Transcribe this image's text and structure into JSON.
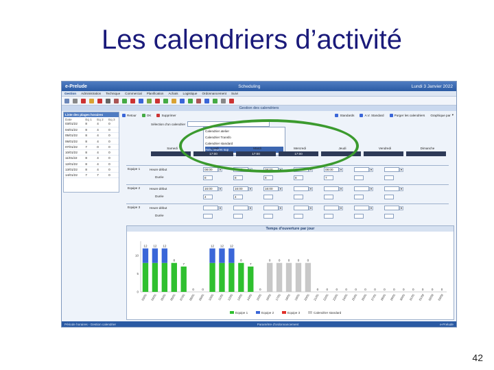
{
  "slide": {
    "title": "Les calendriers d’activité",
    "page_number": "42"
  },
  "app": {
    "brand": "e-Prelude",
    "window_title": "Scheduling",
    "date": "Lundi 3 Janvier 2022",
    "menu": [
      "Gestion",
      "Administration",
      "Technique",
      "Commercial",
      "Planification",
      "Achats",
      "Logistique",
      "Ordonnancement",
      "Suivi"
    ],
    "section_title": "Gestion des calendriers",
    "left_panel": {
      "header": "Liste des plages horaires",
      "columns": [
        "Date",
        "Eq 1",
        "Eq 2",
        "Eq 3"
      ],
      "rows": [
        [
          "03/01/22",
          "8",
          "4",
          "0"
        ],
        [
          "04/01/22",
          "8",
          "4",
          "0"
        ],
        [
          "05/01/22",
          "8",
          "4",
          "0"
        ],
        [
          "06/01/22",
          "8",
          "4",
          "0"
        ],
        [
          "07/01/22",
          "7",
          "0",
          "0"
        ],
        [
          "10/01/22",
          "8",
          "4",
          "0"
        ],
        [
          "11/01/22",
          "8",
          "4",
          "0"
        ],
        [
          "12/01/22",
          "8",
          "4",
          "0"
        ],
        [
          "13/01/22",
          "8",
          "4",
          "0"
        ],
        [
          "14/01/22",
          "7",
          "7",
          "0"
        ]
      ]
    },
    "actions": {
      "back": "Retour",
      "ok": "OK",
      "delete": "Supprimer",
      "standards": "Standards",
      "std": "A.V. Standard",
      "purge": "Purger les calendriers",
      "chart_by": "Graphique par"
    },
    "calendar_select_label": "Sélection d'un calendrier",
    "dropdown_options": [
      "Calendrier atelier",
      "Calendrier Transfo",
      "Calendrier standard",
      "Avec heures sup"
    ],
    "days": [
      "Samedi",
      "Lundi",
      "Mardi",
      "Mercredi",
      "Jeudi",
      "Vendredi",
      "Dimanche"
    ],
    "day_cells": [
      "",
      "17:00",
      "17:00",
      "17:00",
      "",
      "",
      ""
    ],
    "teams": [
      {
        "name": "Equipe 1",
        "start_label": "Heure début",
        "duration_label": "Durée",
        "starts": [
          "08:00",
          "08:00",
          "08:00",
          "07:00",
          "08:00"
        ],
        "durations": [
          "8",
          "8",
          "8",
          "8",
          "7"
        ]
      },
      {
        "name": "Equipe 2",
        "start_label": "Heure début",
        "duration_label": "Durée",
        "starts": [
          "16:00",
          "16:00",
          "16:00"
        ],
        "durations": [
          "4",
          "4",
          ""
        ]
      },
      {
        "name": "Equipe 3",
        "start_label": "Heure début",
        "duration_label": "Durée",
        "starts": [],
        "durations": []
      }
    ],
    "status_left": "Période horaires - Gestion calendrier",
    "status_mid": "Paramètre d'ordonnancement",
    "status_right": "e-Prelude"
  },
  "colors": {
    "team1": "#2fc02f",
    "team2": "#3a66d8",
    "team3": "#e0302a",
    "standard": "#c8c8c8",
    "highlight": "#3b9a2e",
    "title": "#1a1a7a"
  },
  "chart_data": {
    "type": "bar",
    "title": "Temps d'ouverture par jour",
    "ylim": [
      0,
      14
    ],
    "categories": [
      "03/01",
      "04/01",
      "05/01",
      "06/01",
      "07/01",
      "08/01",
      "09/01",
      "10/01",
      "11/01",
      "12/01",
      "13/01",
      "14/01",
      "15/01",
      "16/01",
      "17/01",
      "18/01",
      "19/01",
      "20/01",
      "21/01",
      "22/01",
      "23/01",
      "24/01",
      "25/01",
      "26/01",
      "27/01",
      "28/01",
      "29/01",
      "30/01",
      "31/01",
      "01/02",
      "02/02",
      "03/02"
    ],
    "series": [
      {
        "name": "Equipe 1",
        "values": [
          8,
          8,
          8,
          8,
          7,
          0,
          0,
          8,
          8,
          8,
          8,
          7,
          0,
          0,
          0,
          0,
          0,
          0,
          0,
          0,
          0,
          0,
          0,
          0,
          0,
          0,
          0,
          0,
          0,
          0,
          0,
          0
        ]
      },
      {
        "name": "Equipe 2",
        "values": [
          4,
          4,
          4,
          0,
          0,
          0,
          0,
          4,
          4,
          4,
          0,
          0,
          0,
          0,
          0,
          0,
          0,
          0,
          0,
          0,
          0,
          0,
          0,
          0,
          0,
          0,
          0,
          0,
          0,
          0,
          0,
          0
        ]
      },
      {
        "name": "Equipe 3",
        "values": [
          0,
          0,
          0,
          0,
          0,
          0,
          0,
          0,
          0,
          0,
          0,
          0,
          0,
          0,
          0,
          0,
          0,
          0,
          0,
          0,
          0,
          0,
          0,
          0,
          0,
          0,
          0,
          0,
          0,
          0,
          0,
          0
        ]
      },
      {
        "name": "Calendrier standard",
        "values": [
          0,
          0,
          0,
          0,
          0,
          0,
          0,
          0,
          0,
          0,
          0,
          0,
          0,
          8,
          8,
          8,
          8,
          8,
          0,
          0,
          0,
          0,
          0,
          0,
          0,
          0,
          0,
          0,
          0,
          0,
          0,
          0
        ]
      }
    ],
    "totals": [
      "12",
      "12",
      "12",
      "8",
      "7",
      "0",
      "0",
      "12",
      "12",
      "12",
      "8",
      "7",
      "0",
      "0",
      "0",
      "0",
      "0",
      "0",
      "0",
      "0",
      "0",
      "0",
      "0",
      "0",
      "0",
      "0",
      "0",
      "0",
      "0",
      "0",
      "0",
      "0"
    ],
    "legend": [
      "Equipe 1",
      "Equipe 2",
      "Equipe 3",
      "Calendrier standard"
    ],
    "legend_position": "bottom"
  }
}
